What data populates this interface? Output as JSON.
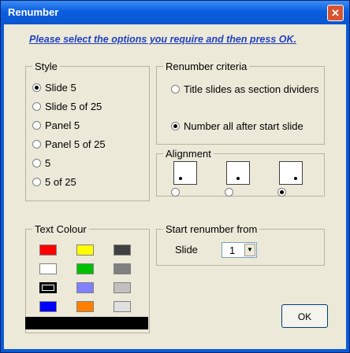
{
  "window": {
    "title": "Renumber",
    "close_symbol": "✕"
  },
  "instruction": "Please select the options you require and then press OK.",
  "style": {
    "legend": "Style",
    "options": [
      "Slide 5",
      "Slide 5 of 25",
      "Panel 5",
      "Panel 5 of 25",
      "5",
      "5 of 25"
    ],
    "selected": "Slide 5"
  },
  "criteria": {
    "legend": "Renumber criteria",
    "options": [
      "Title slides as section dividers",
      "Number all after start slide"
    ],
    "selected": "Number all after start slide"
  },
  "alignment": {
    "legend": "Alignment",
    "options": [
      "bottom-left",
      "bottom-center",
      "bottom-right"
    ],
    "selected": "bottom-right"
  },
  "text_colour": {
    "legend": "Text Colour",
    "swatches": [
      "#ff0000",
      "#ffff00",
      "#404040",
      "#ffffff",
      "#00c000",
      "#808080",
      "#000000",
      "#8080ff",
      "#c0c0c0",
      "#0000ff",
      "#ff8000",
      "#e0e0e0"
    ],
    "selected_color": "#000000"
  },
  "start": {
    "legend": "Start renumber from",
    "label": "Slide",
    "value": "1"
  },
  "ok_label": "OK"
}
